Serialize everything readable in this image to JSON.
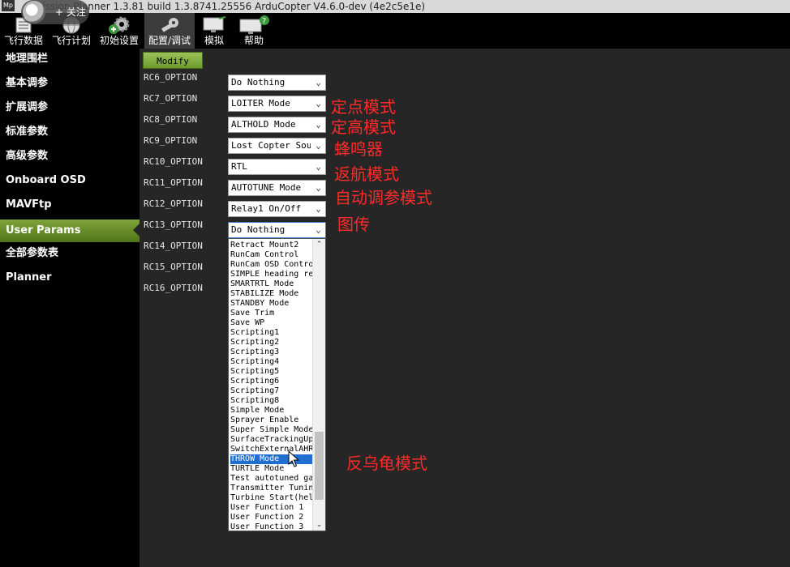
{
  "window": {
    "title": "Mission Planner 1.3.81 build 1.3.8741.25556 ArduCopter V4.6.0-dev (4e2c5e1e)",
    "app_icon": "Mp"
  },
  "overlay": {
    "follow_label": "+ 关注"
  },
  "toolbar": {
    "buttons": [
      {
        "label": "飞行数据",
        "icon": "flight-data-icon"
      },
      {
        "label": "飞行计划",
        "icon": "globe-icon"
      },
      {
        "label": "初始设置",
        "icon": "gear-plus-icon"
      },
      {
        "label": "配置/调试",
        "icon": "wrench-icon"
      },
      {
        "label": "模拟",
        "icon": "monitor-icon"
      },
      {
        "label": "帮助",
        "icon": "help-monitor-icon"
      }
    ]
  },
  "sidebar": {
    "items": [
      {
        "label": "地理围栏"
      },
      {
        "label": "基本调参"
      },
      {
        "label": "扩展调参"
      },
      {
        "label": "标准参数"
      },
      {
        "label": "高级参数"
      },
      {
        "label": "Onboard OSD"
      },
      {
        "label": "MAVFtp"
      },
      {
        "label": "User Params",
        "active": true
      },
      {
        "label": "全部参数表"
      },
      {
        "label": "Planner"
      }
    ]
  },
  "main": {
    "modify_label": "Modify",
    "params": [
      {
        "name": "RC6_OPTION",
        "value": "Do Nothing"
      },
      {
        "name": "RC7_OPTION",
        "value": "LOITER Mode"
      },
      {
        "name": "RC8_OPTION",
        "value": "ALTHOLD Mode"
      },
      {
        "name": "RC9_OPTION",
        "value": "Lost Copter Soun"
      },
      {
        "name": "RC10_OPTION",
        "value": "RTL"
      },
      {
        "name": "RC11_OPTION",
        "value": "AUTOTUNE Mode"
      },
      {
        "name": "RC12_OPTION",
        "value": "Relay1 On/Off"
      },
      {
        "name": "RC13_OPTION",
        "value": "Do Nothing"
      },
      {
        "name": "RC14_OPTION"
      },
      {
        "name": "RC15_OPTION"
      },
      {
        "name": "RC16_OPTION"
      }
    ],
    "dropdown": {
      "options": [
        "Retract Mount2",
        "RunCam Control",
        "RunCam OSD Control",
        "SIMPLE heading reset",
        "SMARTRTL Mode",
        "STABILIZE Mode",
        "STANDBY Mode",
        "Save Trim",
        "Save WP",
        "Scripting1",
        "Scripting2",
        "Scripting3",
        "Scripting4",
        "Scripting5",
        "Scripting6",
        "Scripting7",
        "Scripting8",
        "Simple Mode",
        "Sprayer Enable",
        "Super Simple Mode",
        "SurfaceTrackingUp",
        "SwitchExternalAHRS",
        "THROW Mode",
        "TURTLE Mode",
        "Test autotuned gains",
        "Transmitter Tuning",
        "Turbine Start(heli)",
        "User Function 1",
        "User Function 2",
        "User Function 3"
      ],
      "selected": "THROW Mode"
    }
  },
  "annotations": [
    {
      "text": "定点模式"
    },
    {
      "text": "定高模式"
    },
    {
      "text": "蜂鸣器"
    },
    {
      "text": "返航模式"
    },
    {
      "text": "自动调参模式"
    },
    {
      "text": "图传"
    },
    {
      "text": "反乌龟模式"
    }
  ],
  "colors": {
    "annotation": "#ff2a2a",
    "active_menu": "#6d9a2c",
    "selection": "#1f6fd0"
  }
}
